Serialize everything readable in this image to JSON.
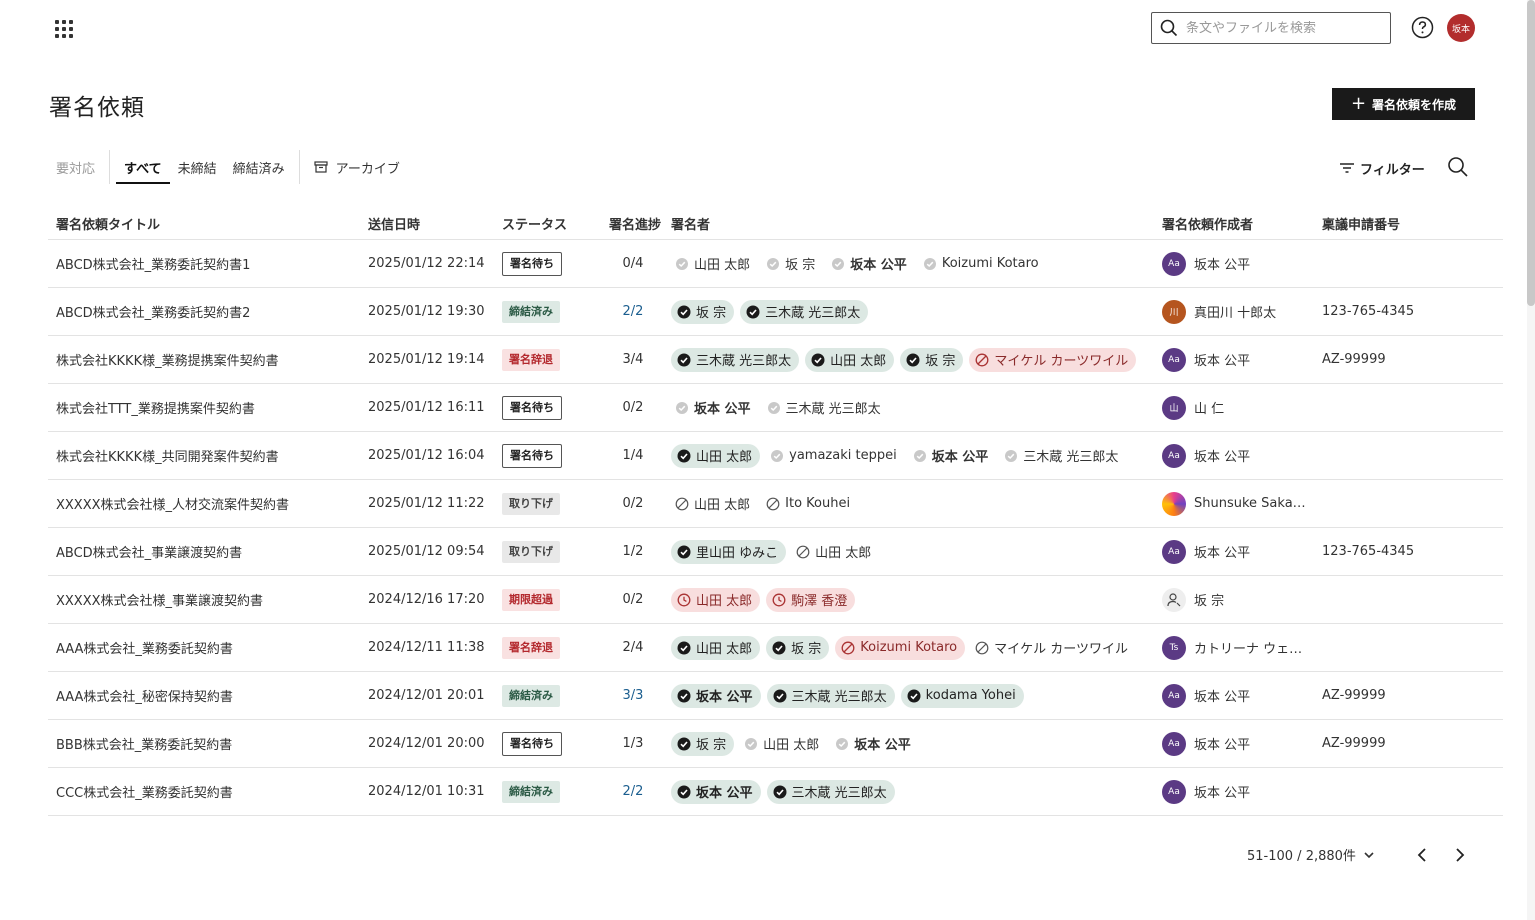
{
  "header": {
    "search_placeholder": "条文やファイルを検索",
    "user_initials": "坂本"
  },
  "page": {
    "title": "署名依頼",
    "create_label": "署名依頼を作成"
  },
  "tabs": [
    {
      "label": "要対応",
      "state": "muted"
    },
    {
      "label": "すべて",
      "state": "active"
    },
    {
      "label": "未締結",
      "state": "normal"
    },
    {
      "label": "締結済み",
      "state": "normal"
    },
    {
      "label": "アーカイブ",
      "state": "archive"
    }
  ],
  "toolbar": {
    "filter_label": "フィルター"
  },
  "columns": {
    "title": "署名依頼タイトル",
    "date": "送信日時",
    "status": "ステータス",
    "progress": "署名進捗",
    "signers": "署名者",
    "creator": "署名依頼作成者",
    "number": "稟議申請番号"
  },
  "status_colors": {
    "waiting": "#222222",
    "done": "#2b5a45",
    "declined": "#b3282d",
    "withdrawn": "#444444",
    "expired": "#b3282d"
  },
  "rows": [
    {
      "title": "ABCD株式会社_業務委託契約書1",
      "date": "2025/01/12 22:14",
      "status": "署名待ち",
      "status_kind": "waiting",
      "progress": "0/4",
      "signers": [
        {
          "name": "山田 太郎",
          "state": "pending"
        },
        {
          "name": "坂 宗",
          "state": "pending"
        },
        {
          "name": "坂本 公平",
          "state": "pending",
          "bold": true
        },
        {
          "name": "Koizumi Kotaro",
          "state": "pending"
        }
      ],
      "creator": {
        "name": "坂本 公平",
        "avatar": "Aa",
        "avatar_kind": "purple"
      },
      "number": ""
    },
    {
      "title": "ABCD株式会社_業務委託契約書2",
      "date": "2025/01/12 19:30",
      "status": "締結済み",
      "status_kind": "done",
      "progress": "2/2",
      "signers": [
        {
          "name": "坂 宗",
          "state": "signed"
        },
        {
          "name": "三木蔵 光三郎太",
          "state": "signed"
        }
      ],
      "creator": {
        "name": "真田川 十郎太",
        "avatar": "川",
        "avatar_kind": "brown"
      },
      "number": "123-765-4345"
    },
    {
      "title": "株式会社KKKK様_業務提携案件契約書",
      "date": "2025/01/12 19:14",
      "status": "署名辞退",
      "status_kind": "declined",
      "progress": "3/4",
      "signers": [
        {
          "name": "三木蔵 光三郎太",
          "state": "signed"
        },
        {
          "name": "山田 太郎",
          "state": "signed"
        },
        {
          "name": "坂 宗",
          "state": "signed"
        },
        {
          "name": "マイケル カーツワイル",
          "state": "declined"
        }
      ],
      "creator": {
        "name": "坂本 公平",
        "avatar": "Aa",
        "avatar_kind": "purple"
      },
      "number": "AZ-99999"
    },
    {
      "title": "株式会社TTT_業務提携案件契約書",
      "date": "2025/01/12 16:11",
      "status": "署名待ち",
      "status_kind": "waiting",
      "progress": "0/2",
      "signers": [
        {
          "name": "坂本 公平",
          "state": "pending",
          "bold": true
        },
        {
          "name": "三木蔵 光三郎太",
          "state": "pending"
        }
      ],
      "creator": {
        "name": "山 仁",
        "avatar": "山",
        "avatar_kind": "purple"
      },
      "number": ""
    },
    {
      "title": "株式会社KKKK様_共同開発案件契約書",
      "date": "2025/01/12 16:04",
      "status": "署名待ち",
      "status_kind": "waiting",
      "progress": "1/4",
      "signers": [
        {
          "name": "山田 太郎",
          "state": "signed"
        },
        {
          "name": "yamazaki teppei",
          "state": "pending"
        },
        {
          "name": "坂本 公平",
          "state": "pending",
          "bold": true
        },
        {
          "name": "三木蔵 光三郎太",
          "state": "pending"
        }
      ],
      "creator": {
        "name": "坂本 公平",
        "avatar": "Aa",
        "avatar_kind": "purple"
      },
      "number": ""
    },
    {
      "title": "XXXXX株式会社様_人材交流案件契約書",
      "date": "2025/01/12 11:22",
      "status": "取り下げ",
      "status_kind": "withdrawn",
      "progress": "0/2",
      "signers": [
        {
          "name": "山田 太郎",
          "state": "cancelled"
        },
        {
          "name": "Ito Kouhei",
          "state": "cancelled"
        }
      ],
      "creator": {
        "name": "Shunsuke Saka…",
        "avatar": "",
        "avatar_kind": "photo"
      },
      "number": ""
    },
    {
      "title": "ABCD株式会社_事業譲渡契約書",
      "date": "2025/01/12 09:54",
      "status": "取り下げ",
      "status_kind": "withdrawn",
      "progress": "1/2",
      "signers": [
        {
          "name": "里山田 ゆみこ",
          "state": "signed"
        },
        {
          "name": "山田 太郎",
          "state": "cancelled"
        }
      ],
      "creator": {
        "name": "坂本 公平",
        "avatar": "Aa",
        "avatar_kind": "purple"
      },
      "number": "123-765-4345"
    },
    {
      "title": "XXXXX株式会社様_事業譲渡契約書",
      "date": "2024/12/16 17:20",
      "status": "期限超過",
      "status_kind": "expired",
      "progress": "0/2",
      "signers": [
        {
          "name": "山田 太郎",
          "state": "overdue"
        },
        {
          "name": "駒澤 香澄",
          "state": "overdue"
        }
      ],
      "creator": {
        "name": "坂 宗",
        "avatar": "",
        "avatar_kind": "generic"
      },
      "number": ""
    },
    {
      "title": "AAA株式会社_業務委託契約書",
      "date": "2024/12/11 11:38",
      "status": "署名辞退",
      "status_kind": "declined",
      "progress": "2/4",
      "signers": [
        {
          "name": "山田 太郎",
          "state": "signed"
        },
        {
          "name": "坂 宗",
          "state": "signed"
        },
        {
          "name": "Koizumi Kotaro",
          "state": "declined"
        },
        {
          "name": "マイケル カーツワイル",
          "state": "cancelled"
        }
      ],
      "creator": {
        "name": "カトリーナ ウェ…",
        "avatar": "Ts",
        "avatar_kind": "purple"
      },
      "number": ""
    },
    {
      "title": "AAA株式会社_秘密保持契約書",
      "date": "2024/12/01 20:01",
      "status": "締結済み",
      "status_kind": "done",
      "progress": "3/3",
      "signers": [
        {
          "name": "坂本 公平",
          "state": "signed",
          "bold": true
        },
        {
          "name": "三木蔵 光三郎太",
          "state": "signed"
        },
        {
          "name": "kodama Yohei",
          "state": "signed"
        }
      ],
      "creator": {
        "name": "坂本 公平",
        "avatar": "Aa",
        "avatar_kind": "purple"
      },
      "number": "AZ-99999"
    },
    {
      "title": "BBB株式会社_業務委託契約書",
      "date": "2024/12/01 20:00",
      "status": "署名待ち",
      "status_kind": "waiting",
      "progress": "1/3",
      "signers": [
        {
          "name": "坂 宗",
          "state": "signed"
        },
        {
          "name": "山田 太郎",
          "state": "pending"
        },
        {
          "name": "坂本 公平",
          "state": "pending",
          "bold": true
        }
      ],
      "creator": {
        "name": "坂本 公平",
        "avatar": "Aa",
        "avatar_kind": "purple"
      },
      "number": "AZ-99999"
    },
    {
      "title": "CCC株式会社_業務委託契約書",
      "date": "2024/12/01 10:31",
      "status": "締結済み",
      "status_kind": "done",
      "progress": "2/2",
      "signers": [
        {
          "name": "坂本 公平",
          "state": "signed",
          "bold": true
        },
        {
          "name": "三木蔵 光三郎太",
          "state": "signed"
        }
      ],
      "creator": {
        "name": "坂本 公平",
        "avatar": "Aa",
        "avatar_kind": "purple"
      },
      "number": ""
    }
  ],
  "pagination": {
    "range_label": "51-100 / 2,880件"
  },
  "icons": {
    "menu": "grid-icon",
    "search": "search-icon",
    "help": "help-icon",
    "plus": "plus-icon",
    "archive": "archive-icon",
    "filter": "filter-icon",
    "signed": "check-circle-icon",
    "pending": "pending-check-icon",
    "declined": "declined-circle-icon",
    "cancelled": "cancelled-circle-icon",
    "overdue": "clock-icon",
    "prev": "chevron-left-icon",
    "next": "chevron-right-icon",
    "dropdown": "chevron-down-icon",
    "generic_user": "user-outline-icon"
  }
}
